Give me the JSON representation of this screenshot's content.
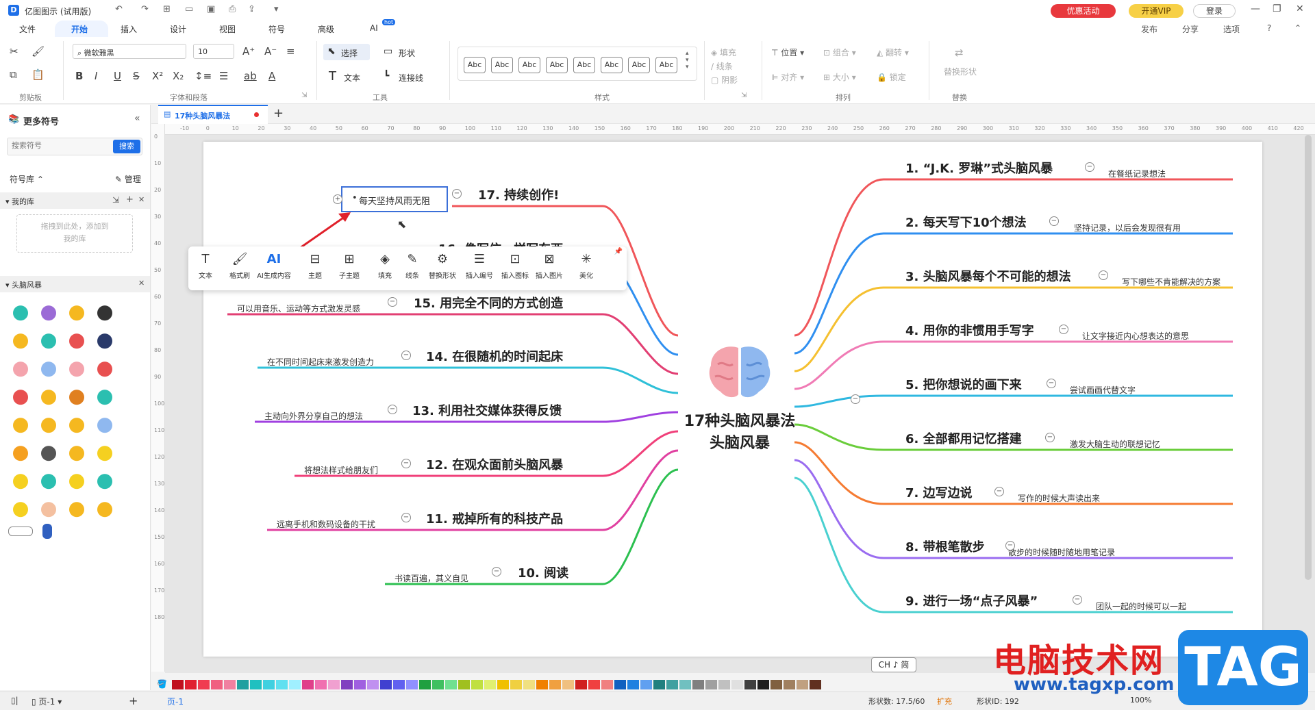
{
  "app": {
    "title": "亿图图示 (试用版)",
    "promo": "优惠活动",
    "vip": "开通VIP",
    "login": "登录",
    "actions": [
      "发布",
      "分享",
      "选项"
    ]
  },
  "menu": {
    "tabs": [
      "文件",
      "开始",
      "插入",
      "设计",
      "视图",
      "符号",
      "高级",
      "AI"
    ],
    "active": "开始",
    "ai_badge": "hot"
  },
  "ribbon": {
    "font_name": "微软雅黑",
    "font_size": "10",
    "select": "选择",
    "shape": "形状",
    "text": "文本",
    "connector": "连接线",
    "style_samples": [
      "Abc",
      "Abc",
      "Abc",
      "Abc",
      "Abc",
      "Abc",
      "Abc",
      "Abc"
    ],
    "fill": "填充",
    "line": "线条",
    "shadow": "阴影",
    "position": "位置",
    "group": "组合",
    "flip": "翻转",
    "align": "对齐",
    "size": "大小",
    "lock": "锁定",
    "replace_shape": "替换形状",
    "groups": [
      "剪贴板",
      "字体和段落",
      "工具",
      "样式",
      "排列",
      "替换"
    ]
  },
  "sidebar": {
    "title": "更多符号",
    "search_placeholder": "搜索符号",
    "search_btn": "搜索",
    "lib_label": "符号库",
    "manage": "管理",
    "my_lib": "我的库",
    "drop_hint": "拖拽到此处，添加到我的库",
    "category": "头脑风暴"
  },
  "document": {
    "tab": "17种头脑风暴法"
  },
  "mindmap": {
    "center_line1": "17种头脑风暴法",
    "center_line2": "头脑风暴",
    "right": [
      {
        "title": "1. “J.K. 罗琳”式头脑风暴",
        "note": "在餐纸记录想法"
      },
      {
        "title": "2. 每天写下10个想法",
        "note": "坚持记录，以后会发现很有用"
      },
      {
        "title": "3. 头脑风暴每个不可能的想法",
        "note": "写下哪些不肯能解决的方案"
      },
      {
        "title": "4. 用你的非惯用手写字",
        "note": "让文字接近内心想表达的意思"
      },
      {
        "title": "5. 把你想说的画下来",
        "note": "尝试画画代替文字"
      },
      {
        "title": "6. 全部都用记忆搭建",
        "note": "激发大脑生动的联想记忆"
      },
      {
        "title": "7. 边写边说",
        "note": "写作的时候大声读出来"
      },
      {
        "title": "8. 带根笔散步",
        "note": "散步的时候随时随地用笔记录"
      },
      {
        "title": "9. 进行一场“点子风暴”",
        "note": "团队一起的时候可以一起"
      }
    ],
    "left": [
      {
        "title": "17. 持续创作!",
        "note": "每天坚持风雨无阻"
      },
      {
        "title": "16. 像写信一样写东西",
        "note": ""
      },
      {
        "title": "15. 用完全不同的方式创造",
        "note": "可以用音乐、运动等方式激发灵感"
      },
      {
        "title": "14. 在很随机的时间起床",
        "note": "在不同时间起床来激发创造力"
      },
      {
        "title": "13. 利用社交媒体获得反馈",
        "note": "主动向外界分享自己的想法"
      },
      {
        "title": "12. 在观众面前头脑风暴",
        "note": "将想法样式给朋友们"
      },
      {
        "title": "11. 戒掉所有的科技产品",
        "note": "远离手机和数码设备的干扰"
      },
      {
        "title": "10. 阅读",
        "note": "书读百遍，其义自见"
      }
    ]
  },
  "floating_toolbar": [
    "文本",
    "格式刷",
    "AI生成内容",
    "主题",
    "子主题",
    "填充",
    "线条",
    "替换形状",
    "插入编号",
    "插入图标",
    "插入图片",
    "美化"
  ],
  "status": {
    "page_name": "页-1",
    "page_tab": "页-1",
    "shape_count": "形状数: 17.5/60",
    "expand": "扩充",
    "shape_id": "形状ID: 192",
    "zoom": "100%",
    "ime": "CH ♪ 简"
  },
  "watermark": {
    "text": "电脑技术网",
    "url": "www.tagxp.com",
    "tag": "TAG"
  },
  "ruler_h": [
    "-10",
    "0",
    "10",
    "20",
    "30",
    "40",
    "50",
    "60",
    "70",
    "80",
    "90",
    "100",
    "110",
    "120",
    "130",
    "140",
    "150",
    "160",
    "170",
    "180",
    "190",
    "200",
    "210",
    "220",
    "230",
    "240",
    "250",
    "260",
    "270",
    "280",
    "290",
    "300",
    "310",
    "320",
    "330",
    "340",
    "350",
    "360",
    "370",
    "380",
    "390",
    "400",
    "410",
    "420"
  ],
  "ruler_v": [
    "0",
    "10",
    "20",
    "30",
    "40",
    "50",
    "60",
    "70",
    "80",
    "90",
    "100",
    "110",
    "120",
    "130",
    "140",
    "150",
    "160",
    "170",
    "180"
  ],
  "colors": {
    "accent": "#1e6fe8",
    "branch_right": [
      "#f0565a",
      "#2f8ff0",
      "#f5c030",
      "#f07bb5",
      "#2fb8e0",
      "#6acd3b",
      "#f57b32",
      "#9a6cf0",
      "#49d0d0"
    ],
    "branch_left": [
      "#f0565a",
      "#2f8ff0",
      "#e23f73",
      "#2fc0d8",
      "#a040e0",
      "#f0407a",
      "#e040a0",
      "#2cc050"
    ],
    "palette": [
      "#c0101e",
      "#e02030",
      "#f03c50",
      "#f06080",
      "#f080a0",
      "#20a0a0",
      "#20c0c0",
      "#40d0e0",
      "#60e0f0",
      "#a0f0ff",
      "#e0408a",
      "#f070b0",
      "#f0a0d0",
      "#8040c0",
      "#a060e0",
      "#c090f0",
      "#4040d0",
      "#6060f0",
      "#9090ff",
      "#20a040",
      "#40c060",
      "#70e090",
      "#a0c020",
      "#c0e040",
      "#e0f070",
      "#f0c000",
      "#f0d040",
      "#f0e080",
      "#f08000",
      "#f0a040",
      "#f0c080",
      "#d02020",
      "#f04040",
      "#f08080",
      "#1060c0",
      "#2080e0",
      "#60a0f0",
      "#208080",
      "#40a0a0",
      "#70c0c0",
      "#808080",
      "#a0a0a0",
      "#c0c0c0",
      "#e0e0e0",
      "#404040",
      "#202020",
      "#806040",
      "#a08060",
      "#c0a080",
      "#603020"
    ]
  }
}
